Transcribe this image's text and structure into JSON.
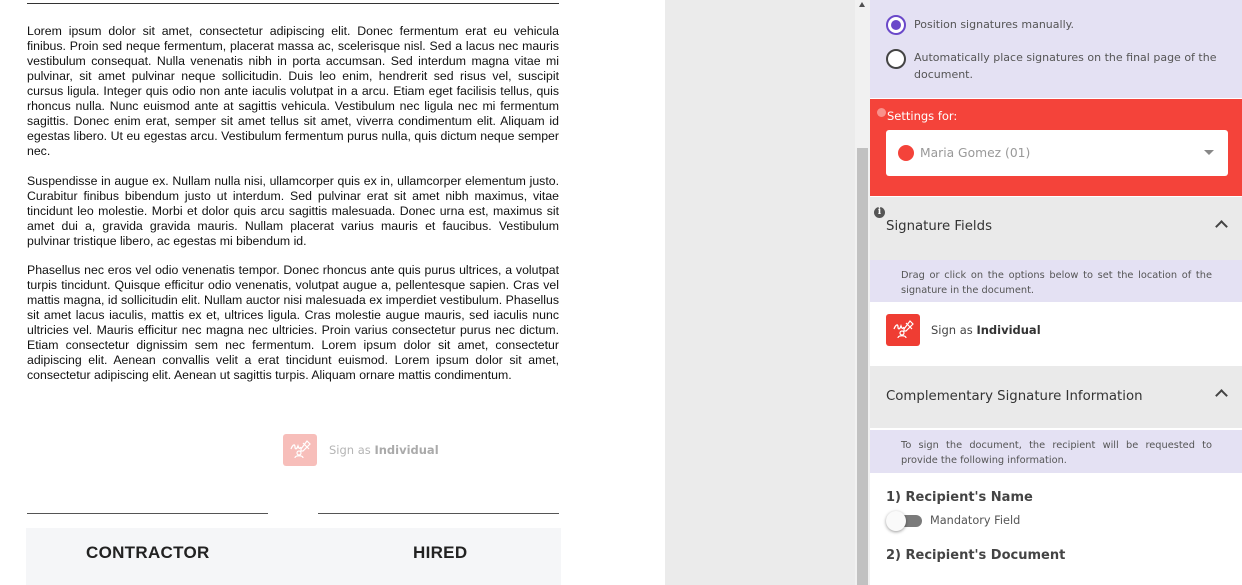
{
  "document": {
    "paragraphs": [
      "Lorem ipsum dolor sit amet, consectetur adipiscing elit. Donec fermentum erat eu vehicula finibus. Proin sed neque fermentum, placerat massa ac, scelerisque nisl. Sed a lacus nec mauris vestibulum consequat. Nulla venenatis nibh in porta accumsan. Sed interdum magna vitae mi pulvinar, sit amet pulvinar neque sollicitudin. Duis leo enim, hendrerit sed risus vel, suscipit cursus ligula. Integer quis odio non ante iaculis volutpat in a arcu. Etiam eget facilisis tellus, quis rhoncus nulla. Nunc euismod ante at sagittis vehicula. Vestibulum nec ligula nec mi fermentum sagittis. Donec enim erat, semper sit amet tellus sit amet, viverra condimentum elit. Aliquam id egestas libero. Ut eu egestas arcu. Vestibulum fermentum purus nulla, quis dictum neque semper nec.",
      "Suspendisse in augue ex. Nullam nulla nisi, ullamcorper quis ex in, ullamcorper elementum justo. Curabitur finibus bibendum justo ut interdum. Sed pulvinar erat sit amet nibh maximus, vitae tincidunt leo molestie. Morbi et dolor quis arcu sagittis malesuada. Donec urna est, maximus sit amet dui a, gravida gravida mauris. Nullam placerat varius mauris et faucibus. Vestibulum pulvinar tristique libero, ac egestas mi bibendum id.",
      "Phasellus nec eros vel odio venenatis tempor. Donec rhoncus ante quis purus ultrices, a volutpat turpis tincidunt. Quisque efficitur odio venenatis, volutpat augue a, pellentesque sapien. Cras vel mattis magna, id sollicitudin elit. Nullam auctor nisi malesuada ex imperdiet vestibulum. Phasellus sit amet lacus iaculis, mattis ex et, ultrices ligula. Cras molestie augue mauris, sed iaculis nunc ultricies vel. Mauris efficitur nec magna nec ultricies. Proin varius consectetur purus nec dictum. Etiam consectetur dignissim sem nec fermentum. Lorem ipsum dolor sit amet, consectetur adipiscing elit. Aenean convallis velit a erat tincidunt euismod. Lorem ipsum dolor sit amet, consectetur adipiscing elit. Aenean ut sagittis turpis. Aliquam ornare mattis condimentum."
    ],
    "placed_field": {
      "label_prefix": "Sign as ",
      "label_strong": "Individual"
    },
    "roles": {
      "left": "CONTRACTOR",
      "right": "HIRED"
    }
  },
  "panel": {
    "position_options": [
      {
        "label": "Position signatures manually.",
        "selected": true
      },
      {
        "label": "Automatically place signatures on the final page of the document.",
        "selected": false
      }
    ],
    "settings_for": {
      "label": "Settings for:",
      "recipient": "Maria Gomez (01)",
      "recipient_color": "#f4433a"
    },
    "signature_fields": {
      "title": "Signature Fields",
      "description": "Drag or click on the options below to set the location of the signature in the document.",
      "option": {
        "label_prefix": "Sign as ",
        "label_strong": "Individual",
        "icon": "signature-icon"
      }
    },
    "complementary": {
      "title": "Complementary Signature Information",
      "description": "To sign the document, the recipient will be requested to provide the following information.",
      "fields": [
        {
          "title": "1) Recipient's Name",
          "mandatory_label": "Mandatory Field",
          "mandatory": false
        },
        {
          "title": "2) Recipient's Document"
        }
      ]
    }
  },
  "colors": {
    "accent_red": "#f4433a",
    "accent_purple": "#6a48c9",
    "panel_lavender": "#e4e1f3"
  }
}
